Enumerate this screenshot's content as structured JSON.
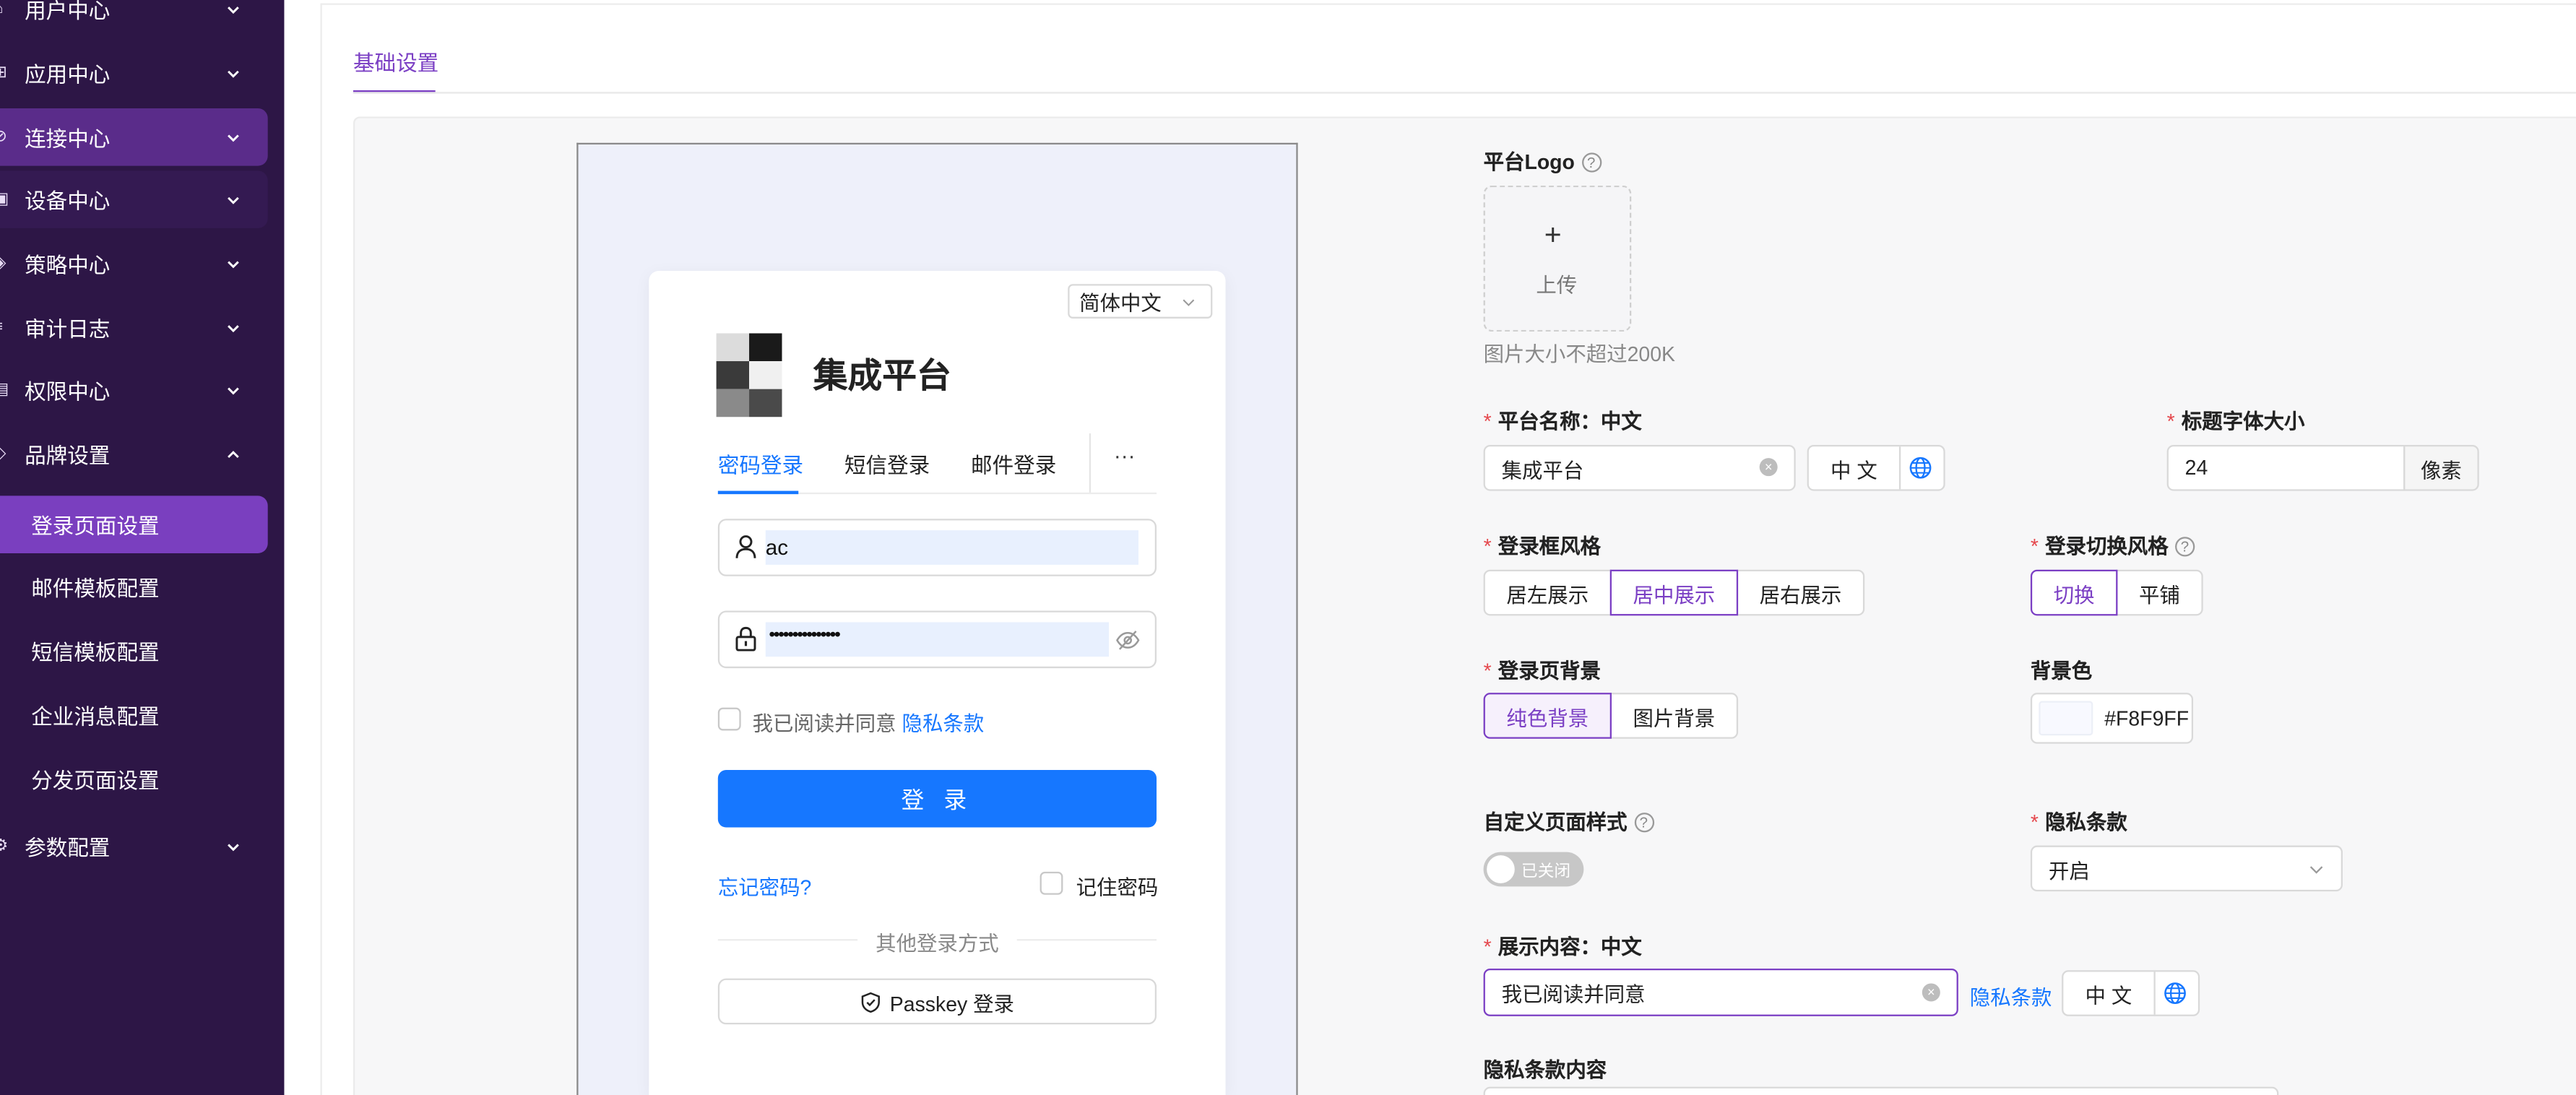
{
  "sidebar": {
    "items": [
      {
        "label": "用户中心",
        "icon": "user-icon"
      },
      {
        "label": "应用中心",
        "icon": "apps-icon"
      },
      {
        "label": "连接中心",
        "icon": "link-icon"
      },
      {
        "label": "设备中心",
        "icon": "device-icon"
      },
      {
        "label": "策略中心",
        "icon": "shield-icon"
      },
      {
        "label": "审计日志",
        "icon": "list-icon"
      },
      {
        "label": "权限中心",
        "icon": "key-icon"
      },
      {
        "label": "品牌设置",
        "icon": "brand-icon"
      }
    ],
    "brand_sub_items": [
      "登录页面设置",
      "邮件模板配置",
      "短信模板配置",
      "企业消息配置",
      "分发页面设置"
    ],
    "params_item": {
      "label": "参数配置",
      "icon": "gear-icon"
    }
  },
  "tabs": {
    "active": "基础设置"
  },
  "preview": {
    "language_select": "简体中文",
    "platform_title": "集成平台",
    "login_tabs": [
      "密码登录",
      "短信登录",
      "邮件登录"
    ],
    "more_label": "···",
    "username_value": "ac",
    "password_value": "•••••••••••••••",
    "agree_text": "我已阅读并同意",
    "agree_link": "隐私条款",
    "login_button": "登 录",
    "forgot_password": "忘记密码?",
    "remember_me": "记住密码",
    "other_methods": "其他登录方式",
    "passkey_button": "Passkey 登录"
  },
  "form": {
    "logo_label": "平台Logo",
    "upload_plus": "+",
    "upload_text": "上传",
    "upload_hint": "图片大小不超过200K",
    "name_label": "平台名称：中文",
    "name_value": "集成平台",
    "lang_label": "中 文",
    "title_size_label": "标题字体大小",
    "title_size_value": "24",
    "title_size_unit": "像素",
    "box_style_label": "登录框风格",
    "box_style_options": [
      "居左展示",
      "居中展示",
      "居右展示"
    ],
    "switch_style_label": "登录切换风格",
    "switch_style_options": [
      "切换",
      "平铺"
    ],
    "bg_label": "登录页背景",
    "bg_options": [
      "纯色背景",
      "图片背景"
    ],
    "bg_color_label": "背景色",
    "bg_color_value": "#F8F9FF",
    "custom_style_label": "自定义页面样式",
    "toggle_text": "已关闭",
    "privacy_label": "隐私条款",
    "privacy_value": "开启",
    "content_label": "展示内容：中文",
    "content_value": "我已阅读并同意",
    "content_link": "隐私条款",
    "privacy_content_label": "隐私条款内容"
  },
  "colors": {
    "sidebar_bg": "#2d1646",
    "accent": "#7b3fc4",
    "primary_button": "#1677ff"
  }
}
